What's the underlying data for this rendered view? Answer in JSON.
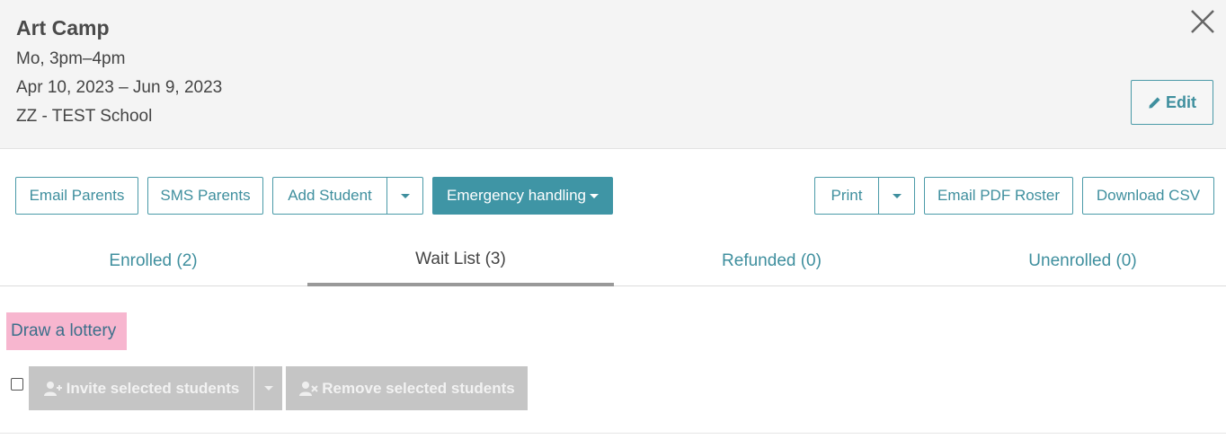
{
  "header": {
    "title": "Art Camp",
    "schedule": "Mo, 3pm–4pm",
    "dates": "Apr 10, 2023 – Jun 9, 2023",
    "school": "ZZ - TEST School",
    "edit_label": "Edit",
    "icons": {
      "close": "close-icon",
      "edit": "pencil-icon"
    }
  },
  "toolbar": {
    "email_parents": "Email Parents",
    "sms_parents": "SMS Parents",
    "add_student": "Add Student",
    "emergency": "Emergency handling",
    "print": "Print",
    "email_pdf": "Email PDF Roster",
    "download_csv": "Download CSV"
  },
  "tabs": [
    {
      "label": "Enrolled (2)"
    },
    {
      "label": "Wait List (3)"
    },
    {
      "label": "Refunded (0)"
    },
    {
      "label": "Unenrolled (0)"
    }
  ],
  "active_tab": "Wait List (3)",
  "waitlist": {
    "lottery_label": "Draw a lottery",
    "invite_label": "Invite selected students",
    "remove_label": "Remove selected students",
    "icons": {
      "invite": "user-plus-icon",
      "remove": "user-remove-icon"
    }
  },
  "colors": {
    "accent": "#3f95a5",
    "header_bg": "#f4f4f4",
    "highlight": "#f7b6cf",
    "disabled": "#c5c5c5"
  }
}
